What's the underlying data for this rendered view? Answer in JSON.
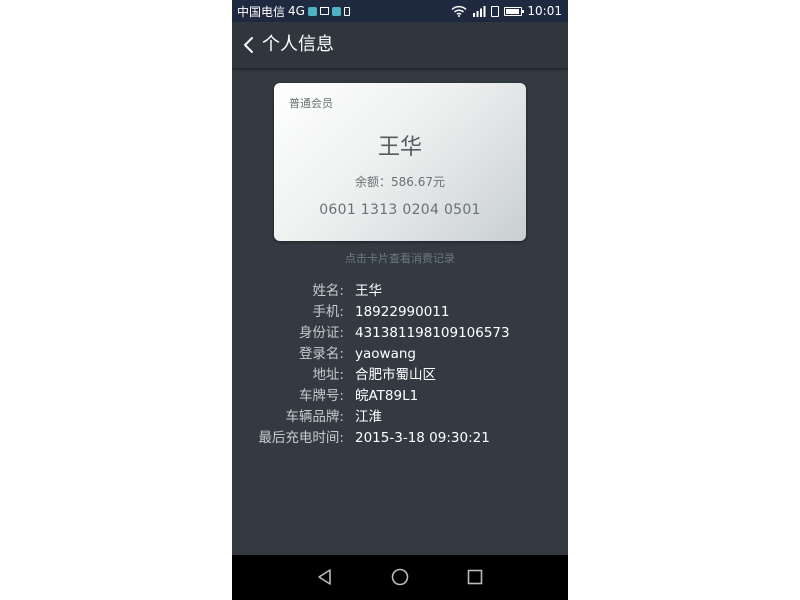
{
  "status_bar": {
    "carrier": "中国电信",
    "network": "4G",
    "time": "10:01",
    "icons": [
      "app-icon",
      "image-icon",
      "app-icon",
      "sim-icon",
      "wifi-icon",
      "signal-icon",
      "phone-icon",
      "battery-icon"
    ]
  },
  "header": {
    "title": "个人信息",
    "back_icon": "chevron-left-icon"
  },
  "card": {
    "type": "普通会员",
    "name": "王华",
    "balance": "余额：586.67元",
    "number": "0601 1313 0204 0501",
    "hint": "点击卡片查看消费记录"
  },
  "info": [
    {
      "label": "姓名:",
      "value": "王华"
    },
    {
      "label": "手机:",
      "value": "18922990011"
    },
    {
      "label": "身份证:",
      "value": "431381198109106573"
    },
    {
      "label": "登录名:",
      "value": "yaowang"
    },
    {
      "label": "地址:",
      "value": "合肥市蜀山区"
    },
    {
      "label": "车牌号:",
      "value": "皖AT89L1"
    },
    {
      "label": "车辆品牌:",
      "value": "江淮"
    },
    {
      "label": "最后充电时间:",
      "value": "2015-3-18 09:30:21"
    }
  ],
  "navbar": {
    "icons": [
      "back-triangle-icon",
      "home-circle-icon",
      "recents-square-icon"
    ]
  },
  "colors": {
    "screen_bg": "#333a42",
    "status_bar_bg": "#1f2940",
    "header_bg": "#2f363e",
    "label": "#c5c9cc",
    "value": "#ffffff"
  }
}
